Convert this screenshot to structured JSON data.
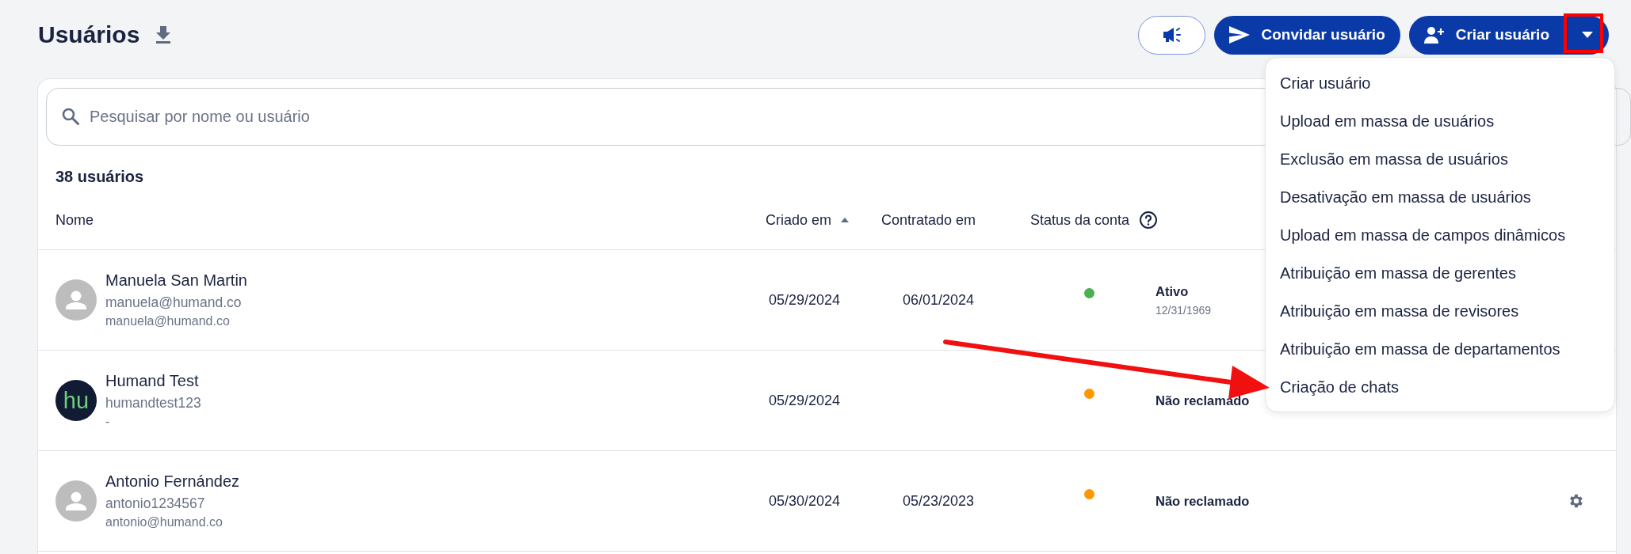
{
  "page": {
    "title": "Usuários"
  },
  "actions": {
    "invite_label": "Convidar usuário",
    "create_label": "Criar usuário"
  },
  "dropdown": {
    "expanded": true,
    "items": [
      {
        "label": "Criar usuário"
      },
      {
        "label": "Upload em massa de usuários"
      },
      {
        "label": "Exclusão em massa de usuários"
      },
      {
        "label": "Desativação em massa de usuários"
      },
      {
        "label": "Upload em massa de campos dinâmicos"
      },
      {
        "label": "Atribuição em massa de gerentes"
      },
      {
        "label": "Atribuição em massa de revisores"
      },
      {
        "label": "Atribuição em massa de departamentos"
      },
      {
        "label": "Criação de chats"
      }
    ]
  },
  "search": {
    "placeholder": "Pesquisar por nome ou usuário"
  },
  "count": "38 usuários",
  "columns": [
    {
      "label": "Nome",
      "kind": "plain"
    },
    {
      "label": "Criado em",
      "kind": "sorted"
    },
    {
      "label": "Contratado em",
      "kind": "plain"
    },
    {
      "label": "Status da conta",
      "kind": "help"
    }
  ],
  "rows": [
    {
      "name": "Manuela San Martin",
      "username": "manuela@humand.co",
      "email": "manuela@humand.co",
      "avatar": {
        "kind": "placeholder"
      },
      "created": "05/29/2024",
      "hired": "06/01/2024",
      "status": {
        "label": "Ativo",
        "date": "12/31/1969",
        "color": "#4caf50"
      },
      "settings_icon": false
    },
    {
      "name": "Humand Test",
      "username": "humandtest123",
      "email": "-",
      "avatar": {
        "kind": "logo",
        "text": "hu"
      },
      "created": "05/29/2024",
      "hired": "",
      "status": {
        "label": "Não reclamado",
        "color": "#ff9800"
      },
      "settings_icon": false
    },
    {
      "name": "Antonio Fernández",
      "username": "antonio1234567",
      "email": "antonio@humand.co",
      "avatar": {
        "kind": "placeholder"
      },
      "created": "05/30/2024",
      "hired": "05/23/2023",
      "status": {
        "label": "Não reclamado",
        "color": "#ff9800"
      },
      "settings_icon": true
    }
  ]
}
